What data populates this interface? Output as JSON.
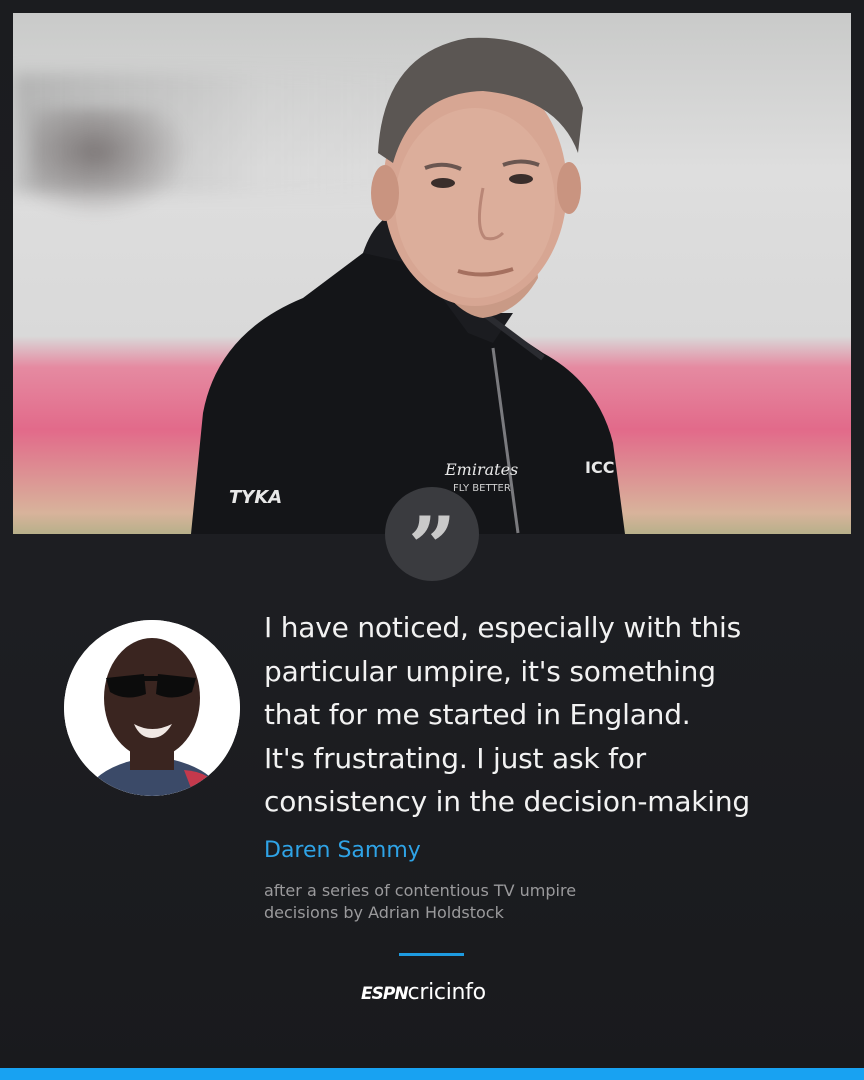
{
  "quote": {
    "mark": "”",
    "text": "I have noticed, especially with this\nparticular umpire, it's something\nthat for me started in England.\nIt's frustrating. I just ask for\nconsistency in the decision-making"
  },
  "speaker": {
    "name": "Daren Sammy"
  },
  "context": {
    "text": "after a series of contentious TV umpire\ndecisions by Adrian Holdstock"
  },
  "photo": {
    "jacket_logos": [
      "TYKA",
      "Emirates",
      "FLY BETTER",
      "ICC"
    ]
  },
  "brand": {
    "espn": "ESPN",
    "cricinfo": "cricinfo"
  },
  "colors": {
    "accent": "#1e9be0",
    "speaker": "#2fa3e6",
    "background": "#1c1d20"
  }
}
